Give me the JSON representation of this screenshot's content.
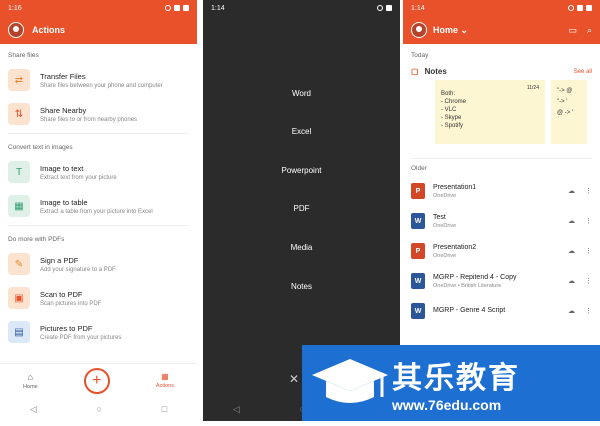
{
  "colors": {
    "accent": "#e8512a",
    "watermark": "#1e6fd2"
  },
  "screen1": {
    "time": "1:16",
    "title": "Actions",
    "sections": [
      {
        "label": "Share files",
        "items": [
          {
            "title": "Transfer Files",
            "sub": "Share files between your phone and computer",
            "icon": "transfer-icon"
          },
          {
            "title": "Share Nearby",
            "sub": "Share files to or from nearby phones",
            "icon": "share-nearby-icon"
          }
        ]
      },
      {
        "label": "Convert text in images",
        "items": [
          {
            "title": "Image to text",
            "sub": "Extract text from your picture",
            "icon": "image-text-icon"
          },
          {
            "title": "Image to table",
            "sub": "Extract a table from your picture into Excel",
            "icon": "image-table-icon"
          }
        ]
      },
      {
        "label": "Do more with PDFs",
        "items": [
          {
            "title": "Sign a PDF",
            "sub": "Add your signature to a PDF",
            "icon": "sign-pdf-icon"
          },
          {
            "title": "Scan to PDF",
            "sub": "Scan pictures into PDF",
            "icon": "scan-pdf-icon"
          },
          {
            "title": "Pictures to PDF",
            "sub": "Create PDF from your pictures",
            "icon": "pictures-pdf-icon"
          }
        ]
      }
    ],
    "nav": {
      "home": "Home",
      "actions": "Actions"
    }
  },
  "screen2": {
    "time": "1:14",
    "menu": [
      "Word",
      "Excel",
      "Powerpoint",
      "PDF",
      "Media",
      "Notes"
    ]
  },
  "screen3": {
    "time": "1:14",
    "title": "Home",
    "today": "Today",
    "notes_title": "Notes",
    "see_all": "See all",
    "note_date": "11/24",
    "note_text": "Both:\n- Chrome\n- VLC\n- Skype\n- Spotify",
    "note2_text": "\"-> @\n\"-> '\n@ -> '",
    "older": "Older",
    "files": [
      {
        "name": "Presentation1",
        "loc": "OneDrive",
        "type": "ppt"
      },
      {
        "name": "Test",
        "loc": "OneDrive",
        "type": "doc"
      },
      {
        "name": "Presentation2",
        "loc": "OneDrive",
        "type": "ppt"
      },
      {
        "name": "MGRP - Repitend 4 - Copy",
        "loc": "OneDrive • British Literature",
        "type": "doc"
      },
      {
        "name": "MGRP - Genre 4 Script",
        "loc": "",
        "type": "doc"
      }
    ]
  },
  "watermark": {
    "cn": "其乐教育",
    "url": "www.76edu.com"
  }
}
